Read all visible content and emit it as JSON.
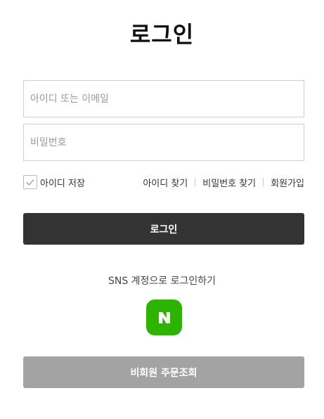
{
  "page": {
    "title": "로그인"
  },
  "form": {
    "id_placeholder": "아이디 또는 이메일",
    "pw_placeholder": "비밀번호",
    "save_id_label": "아이디 저장",
    "save_id_checked": true
  },
  "links": {
    "find_id": "아이디 찾기",
    "find_pw": "비밀번호 찾기",
    "signup": "회원가입"
  },
  "buttons": {
    "login": "로그인",
    "guest_order": "비회원 주문조회"
  },
  "sns": {
    "label": "SNS 계정으로 로그인하기",
    "naver_icon": "naver-icon",
    "naver_color": "#2db400"
  },
  "colors": {
    "login_button": "#333333",
    "guest_button": "#a3a3a3"
  }
}
